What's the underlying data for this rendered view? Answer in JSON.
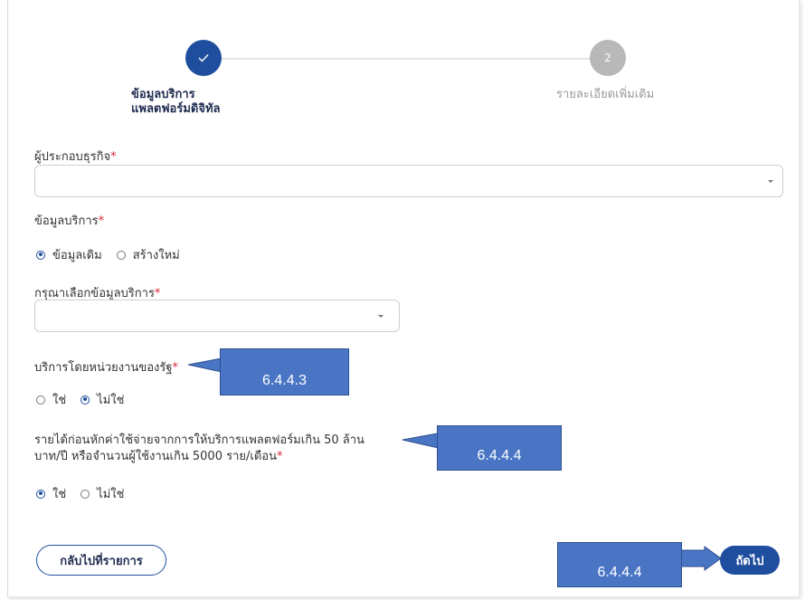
{
  "stepper": {
    "step1_icon": "check-icon",
    "step1_label_line1": "ข้อมูลบริการ",
    "step1_label_line2": "แพลตฟอร์มดิจิทัล",
    "step2_number": "2",
    "step2_label": "รายละเอียดเพิ่มเติม"
  },
  "form": {
    "operator_label": "ผู้ประกอบธุรกิจ",
    "operator_value": "",
    "service_info_label": "ข้อมูลบริการ",
    "service_info_options": [
      "ข้อมูลเดิม",
      "สร้างใหม่"
    ],
    "service_info_selected": "ข้อมูลเดิม",
    "select_service_label": "กรุณาเลือกข้อมูลบริการ",
    "select_service_value": "",
    "gov_agency_label": "บริการโดยหน่วยงานของรัฐ",
    "gov_agency_options": [
      "ใช่",
      "ไม่ใช่"
    ],
    "gov_agency_selected": "ไม่ใช่",
    "revenue_label_line1": "รายได้ก่อนหักค่าใช้จ่ายจากการให้บริการแพลตฟอร์มเกิน 50 ล้าน",
    "revenue_label_line2": "บาท/ปี หรือจำนวนผู้ใช้งานเกิน 5000 ราย/เดือน",
    "revenue_options": [
      "ใช่",
      "ไม่ใช่"
    ],
    "revenue_selected": "ใช่",
    "required_mark": "*"
  },
  "buttons": {
    "back_label": "กลับไปที่รายการ",
    "next_label": "ถัดไป"
  },
  "callouts": {
    "gov_agency": "6.4.4.3",
    "revenue": "6.4.4.4",
    "next": "6.4.4.4"
  },
  "colors": {
    "primary": "#1f4e9e",
    "required": "#e0283a",
    "callout_fill": "#4a75c4"
  }
}
